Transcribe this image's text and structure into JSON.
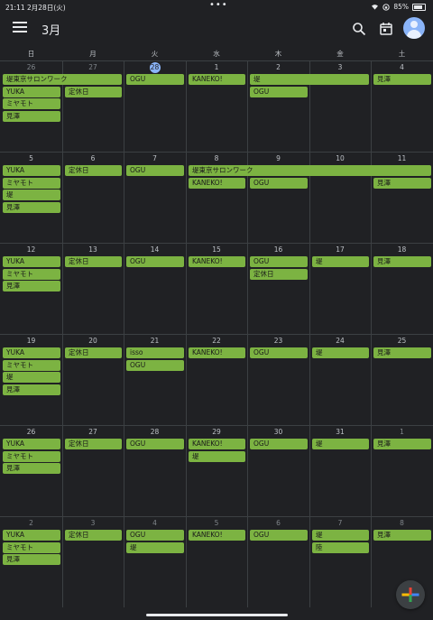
{
  "status": {
    "time": "21:11",
    "date": "2月28日(火)",
    "dots": "•••",
    "battery": "85%"
  },
  "header": {
    "month_title": "3月"
  },
  "weekdays": [
    "日",
    "月",
    "火",
    "水",
    "木",
    "金",
    "土"
  ],
  "weeks": [
    {
      "days": [
        "26",
        "27",
        "28",
        "1",
        "2",
        "3",
        "4"
      ],
      "other_month": [
        true,
        true,
        true,
        false,
        false,
        false,
        false
      ],
      "today_index": 2,
      "events": [
        {
          "label": "堤東京サロンワーク",
          "col": 0,
          "span": 2,
          "row": 0
        },
        {
          "label": "YUKA",
          "col": 0,
          "span": 1,
          "row": 1
        },
        {
          "label": "ミヤモト",
          "col": 0,
          "span": 1,
          "row": 2
        },
        {
          "label": "見澤",
          "col": 0,
          "span": 1,
          "row": 3
        },
        {
          "label": "定休日",
          "col": 1,
          "span": 1,
          "row": 1
        },
        {
          "label": "OGU",
          "col": 2,
          "span": 1,
          "row": 0
        },
        {
          "label": "KANEKO!",
          "col": 3,
          "span": 1,
          "row": 0
        },
        {
          "label": "堤",
          "col": 4,
          "span": 2,
          "row": 0
        },
        {
          "label": "OGU",
          "col": 4,
          "span": 1,
          "row": 1
        },
        {
          "label": "見澤",
          "col": 6,
          "span": 1,
          "row": 0
        }
      ]
    },
    {
      "days": [
        "5",
        "6",
        "7",
        "8",
        "9",
        "10",
        "11"
      ],
      "other_month": [
        false,
        false,
        false,
        false,
        false,
        false,
        false
      ],
      "today_index": -1,
      "events": [
        {
          "label": "YUKA",
          "col": 0,
          "span": 1,
          "row": 0
        },
        {
          "label": "ミヤモト",
          "col": 0,
          "span": 1,
          "row": 1
        },
        {
          "label": "堤",
          "col": 0,
          "span": 1,
          "row": 2
        },
        {
          "label": "見澤",
          "col": 0,
          "span": 1,
          "row": 3
        },
        {
          "label": "定休日",
          "col": 1,
          "span": 1,
          "row": 0
        },
        {
          "label": "OGU",
          "col": 2,
          "span": 1,
          "row": 0
        },
        {
          "label": "堤東京サロンワーク",
          "col": 3,
          "span": 4,
          "row": 0
        },
        {
          "label": "KANEKO!",
          "col": 3,
          "span": 1,
          "row": 1
        },
        {
          "label": "OGU",
          "col": 4,
          "span": 1,
          "row": 1
        },
        {
          "label": "見澤",
          "col": 6,
          "span": 1,
          "row": 1
        }
      ]
    },
    {
      "days": [
        "12",
        "13",
        "14",
        "15",
        "16",
        "17",
        "18"
      ],
      "other_month": [
        false,
        false,
        false,
        false,
        false,
        false,
        false
      ],
      "today_index": -1,
      "events": [
        {
          "label": "YUKA",
          "col": 0,
          "span": 1,
          "row": 0
        },
        {
          "label": "ミヤモト",
          "col": 0,
          "span": 1,
          "row": 1
        },
        {
          "label": "見澤",
          "col": 0,
          "span": 1,
          "row": 2
        },
        {
          "label": "定休日",
          "col": 1,
          "span": 1,
          "row": 0
        },
        {
          "label": "OGU",
          "col": 2,
          "span": 1,
          "row": 0
        },
        {
          "label": "KANEKO!",
          "col": 3,
          "span": 1,
          "row": 0
        },
        {
          "label": "OGU",
          "col": 4,
          "span": 1,
          "row": 0
        },
        {
          "label": "定休日",
          "col": 4,
          "span": 1,
          "row": 1
        },
        {
          "label": "堤",
          "col": 5,
          "span": 1,
          "row": 0
        },
        {
          "label": "見澤",
          "col": 6,
          "span": 1,
          "row": 0
        }
      ]
    },
    {
      "days": [
        "19",
        "20",
        "21",
        "22",
        "23",
        "24",
        "25"
      ],
      "other_month": [
        false,
        false,
        false,
        false,
        false,
        false,
        false
      ],
      "today_index": -1,
      "events": [
        {
          "label": "YUKA",
          "col": 0,
          "span": 1,
          "row": 0
        },
        {
          "label": "ミヤモト",
          "col": 0,
          "span": 1,
          "row": 1
        },
        {
          "label": "堤",
          "col": 0,
          "span": 1,
          "row": 2
        },
        {
          "label": "見澤",
          "col": 0,
          "span": 1,
          "row": 3
        },
        {
          "label": "定休日",
          "col": 1,
          "span": 1,
          "row": 0
        },
        {
          "label": "isso",
          "col": 2,
          "span": 1,
          "row": 0
        },
        {
          "label": "OGU",
          "col": 2,
          "span": 1,
          "row": 1
        },
        {
          "label": "KANEKO!",
          "col": 3,
          "span": 1,
          "row": 0
        },
        {
          "label": "OGU",
          "col": 4,
          "span": 1,
          "row": 0
        },
        {
          "label": "堤",
          "col": 5,
          "span": 1,
          "row": 0
        },
        {
          "label": "見澤",
          "col": 6,
          "span": 1,
          "row": 0
        }
      ]
    },
    {
      "days": [
        "26",
        "27",
        "28",
        "29",
        "30",
        "31",
        "1"
      ],
      "other_month": [
        false,
        false,
        false,
        false,
        false,
        false,
        true
      ],
      "today_index": -1,
      "events": [
        {
          "label": "YUKA",
          "col": 0,
          "span": 1,
          "row": 0
        },
        {
          "label": "ミヤモト",
          "col": 0,
          "span": 1,
          "row": 1
        },
        {
          "label": "見澤",
          "col": 0,
          "span": 1,
          "row": 2
        },
        {
          "label": "定休日",
          "col": 1,
          "span": 1,
          "row": 0
        },
        {
          "label": "OGU",
          "col": 2,
          "span": 1,
          "row": 0
        },
        {
          "label": "KANEKO!",
          "col": 3,
          "span": 1,
          "row": 0
        },
        {
          "label": "堤",
          "col": 3,
          "span": 1,
          "row": 1
        },
        {
          "label": "OGU",
          "col": 4,
          "span": 1,
          "row": 0
        },
        {
          "label": "堤",
          "col": 5,
          "span": 1,
          "row": 0
        },
        {
          "label": "見澤",
          "col": 6,
          "span": 1,
          "row": 0
        }
      ]
    },
    {
      "days": [
        "2",
        "3",
        "4",
        "5",
        "6",
        "7",
        "8"
      ],
      "other_month": [
        true,
        true,
        true,
        true,
        true,
        true,
        true
      ],
      "today_index": -1,
      "events": [
        {
          "label": "YUKA",
          "col": 0,
          "span": 1,
          "row": 0
        },
        {
          "label": "ミヤモト",
          "col": 0,
          "span": 1,
          "row": 1
        },
        {
          "label": "見澤",
          "col": 0,
          "span": 1,
          "row": 2
        },
        {
          "label": "定休日",
          "col": 1,
          "span": 1,
          "row": 0
        },
        {
          "label": "OGU",
          "col": 2,
          "span": 1,
          "row": 0
        },
        {
          "label": "堤",
          "col": 2,
          "span": 1,
          "row": 1
        },
        {
          "label": "KANEKO!",
          "col": 3,
          "span": 1,
          "row": 0
        },
        {
          "label": "OGU",
          "col": 4,
          "span": 1,
          "row": 0
        },
        {
          "label": "堤",
          "col": 5,
          "span": 1,
          "row": 0
        },
        {
          "label": "陸",
          "col": 5,
          "span": 1,
          "row": 1
        },
        {
          "label": "見澤",
          "col": 6,
          "span": 1,
          "row": 0
        }
      ]
    }
  ],
  "colors": {
    "event_bg": "#7cb342",
    "today": "#8ab4f8",
    "background": "#202124"
  },
  "icons": {
    "menu": "menu-icon",
    "search": "search-icon",
    "today": "calendar-today-icon",
    "fab": "add-icon"
  }
}
